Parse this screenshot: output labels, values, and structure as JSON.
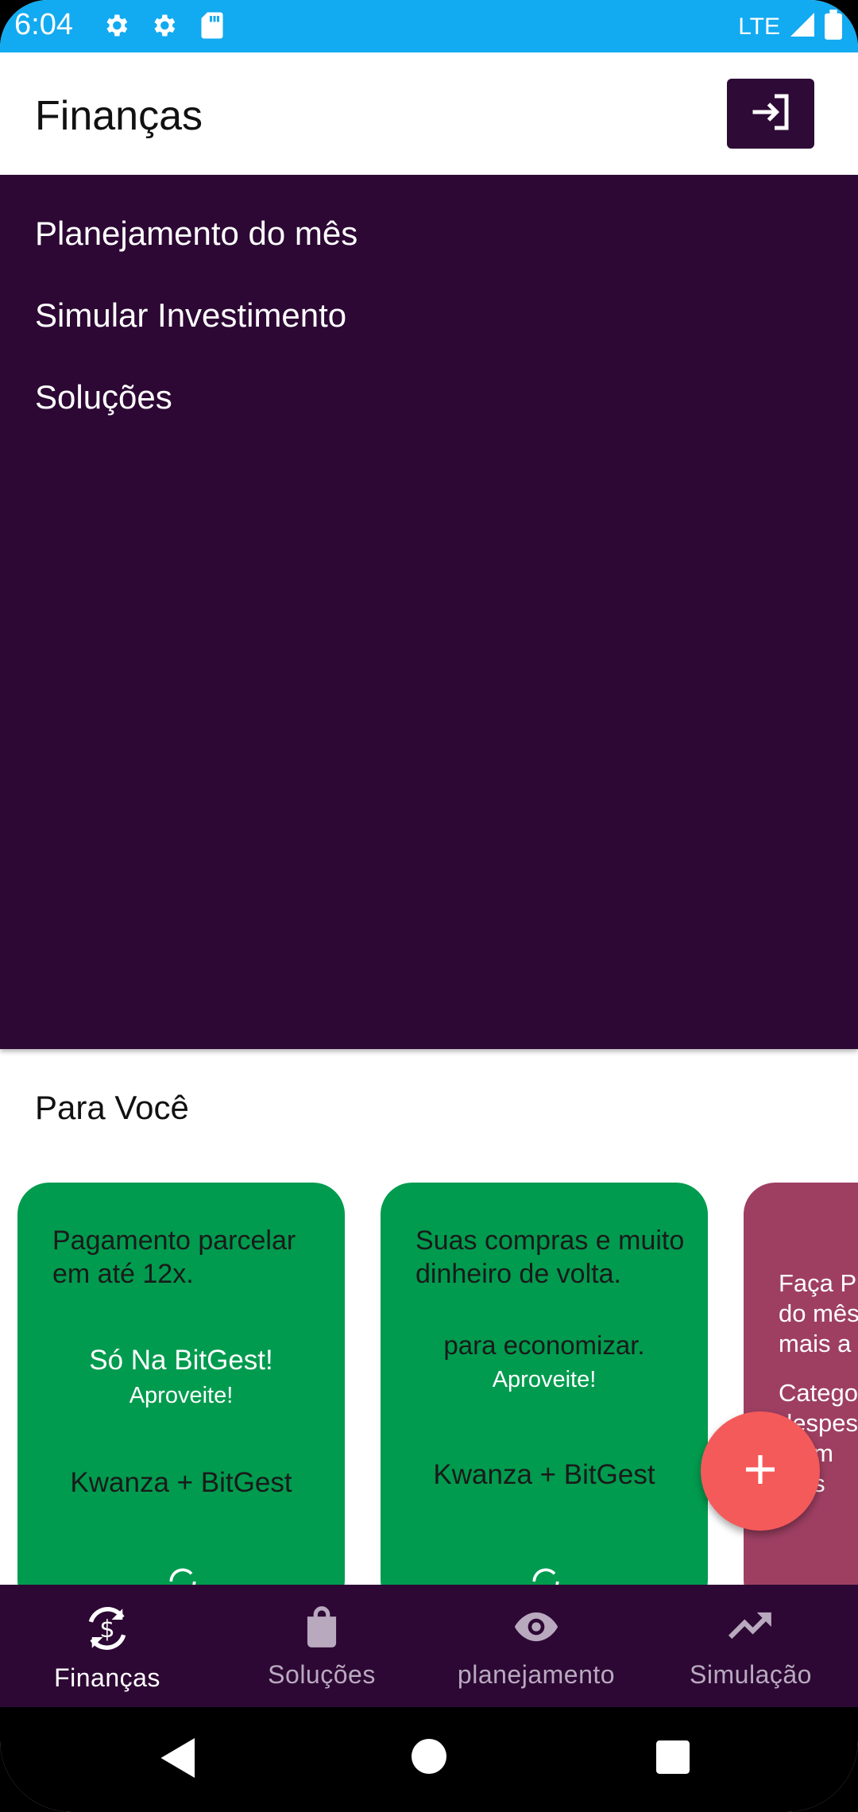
{
  "status_bar": {
    "time": "6:04",
    "network": "LTE"
  },
  "app_bar": {
    "title": "Finanças",
    "login_icon": "login-icon"
  },
  "panel": {
    "items": [
      {
        "label": "Planejamento do mês"
      },
      {
        "label": "Simular Investimento"
      },
      {
        "label": "Soluções"
      }
    ]
  },
  "section": {
    "title": "Para Você"
  },
  "cards": [
    {
      "text": "Pagamento parcelar em até 12x.",
      "headline": "Só Na BitGest!",
      "sub": "Aproveite!",
      "brand": "Kwanza + BitGest",
      "color": "#009b4e"
    },
    {
      "text": "Suas compras e muito dinheiro de volta.",
      "headline": "para economizar.",
      "sub": "Aproveite!",
      "brand": "Kwanza + BitGest",
      "color": "#009b4e"
    },
    {
      "text_lines": [
        "Faça P",
        "do mês",
        "mais a"
      ],
      "text2_lines": [
        "Catego",
        "despes",
        "a em",
        "tuas"
      ],
      "color": "#9e3f62"
    }
  ],
  "fab": {
    "icon": "plus-icon",
    "color": "#f45a5a"
  },
  "bottom_nav": {
    "items": [
      {
        "label": "Finanças",
        "icon": "currency-exchange-icon",
        "active": true
      },
      {
        "label": "Soluções",
        "icon": "shopping-bag-icon",
        "active": false
      },
      {
        "label": "planejamento",
        "icon": "eye-icon",
        "active": false
      },
      {
        "label": "Simulação",
        "icon": "trending-up-icon",
        "active": false
      }
    ]
  },
  "colors": {
    "primary": "#2d0834",
    "status_bar": "#12aaf0",
    "card_green": "#009b4e",
    "card_pink": "#9e3f62",
    "fab": "#f45a5a"
  }
}
